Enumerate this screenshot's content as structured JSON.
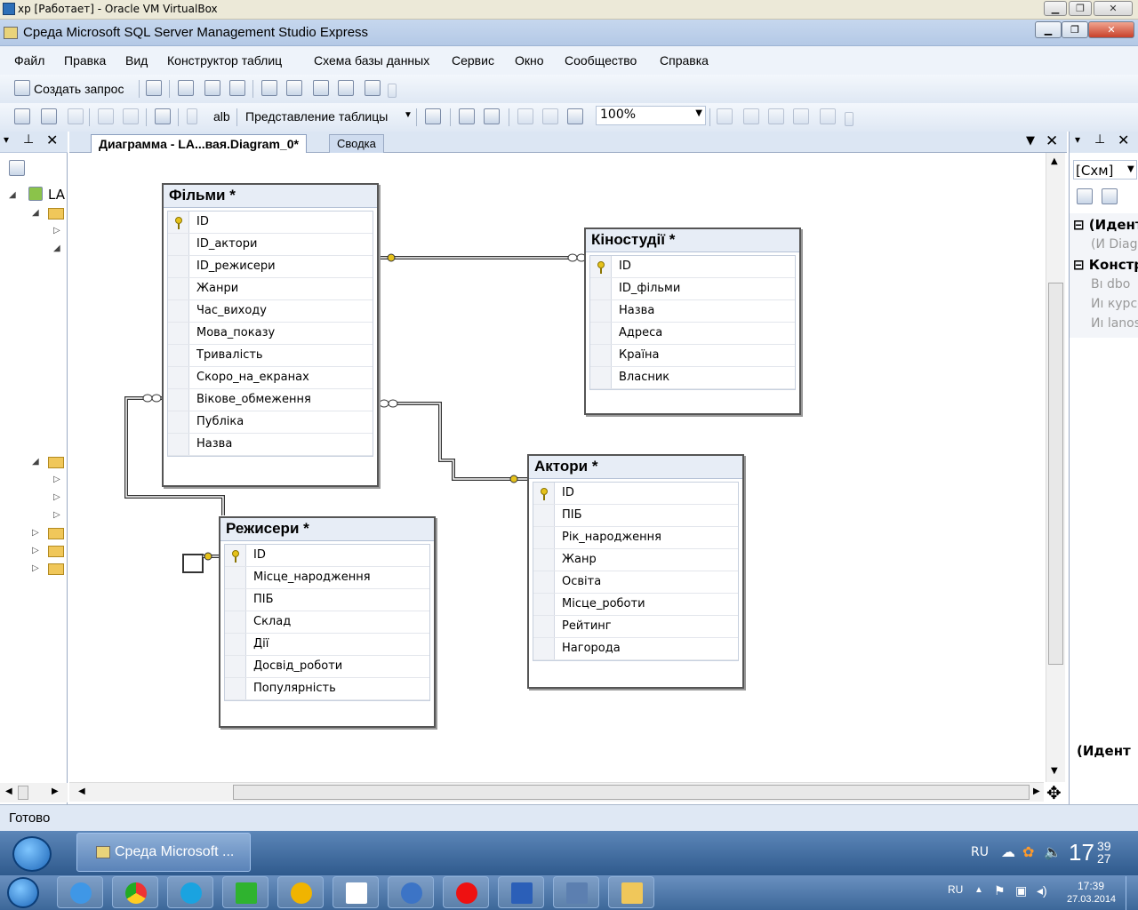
{
  "vbox": {
    "title": "xp [Работает] - Oracle VM VirtualBox"
  },
  "app": {
    "title": "Среда Microsoft SQL Server Management Studio Express"
  },
  "menu": [
    "Файл",
    "Правка",
    "Вид",
    "Конструктор таблиц",
    "Схема базы данных",
    "Сервис",
    "Окно",
    "Сообщество",
    "Справка"
  ],
  "toolbar": {
    "new_query": "Создать запрос",
    "table_view": "Представление таблицы",
    "zoom": "100%",
    "alb": "alb"
  },
  "left_panel": {
    "server_label": "LA"
  },
  "tabs": {
    "diagram": "Диаграмма - LA...вая.Diagram_0*",
    "summary": "Сводка"
  },
  "tables": {
    "films": {
      "title": "Фільми *",
      "columns": [
        "ID",
        "ID_актори",
        "ID_режисери",
        "Жанри",
        "Час_виходу",
        "Мова_показу",
        "Тривалість",
        "Скоро_на_екранах",
        "Вікове_обмеження",
        "Публіка",
        "Назва"
      ]
    },
    "studios": {
      "title": "Кіностудії *",
      "columns": [
        "ID",
        "ID_фільми",
        "Назва",
        "Адреса",
        "Країна",
        "Власник"
      ]
    },
    "actors": {
      "title": "Актори *",
      "columns": [
        "ID",
        "ПІБ",
        "Рік_народження",
        "Жанр",
        "Освіта",
        "Місце_роботи",
        "Рейтинг",
        "Нагорода"
      ]
    },
    "directors": {
      "title": "Режисери *",
      "columns": [
        "ID",
        "Місце_народження",
        "ПІБ",
        "Склад",
        "Дії",
        "Досвід_роботи",
        "Популярність"
      ]
    }
  },
  "right_panel": {
    "dropdown": "[Схм]",
    "section1": "(Идент",
    "item1": "(И Diagr",
    "section2": "Констр",
    "item2": "Вı dbo",
    "item3": "Иı курсо",
    "item4": "Иı lanos",
    "footer": "(Идент"
  },
  "status": {
    "text": "Готово"
  },
  "taskbar": {
    "app_button": "Среда Microsoft ...",
    "lang": "RU",
    "time_big": "17",
    "time_min": "39",
    "time_sec": "27",
    "lang2": "RU",
    "time2": "17:39",
    "date2": "27.03.2014"
  }
}
